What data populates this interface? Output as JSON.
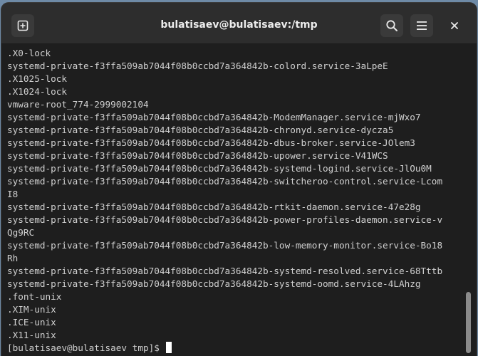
{
  "window": {
    "title": "bulatisaev@bulatisaev:/tmp"
  },
  "titlebar": {
    "new_tab_icon": "new-tab-icon",
    "search_icon": "search-icon",
    "menu_icon": "hamburger-menu-icon",
    "close_icon": "close-icon"
  },
  "terminal": {
    "lines": [
      ".X0-lock",
      "systemd-private-f3ffa509ab7044f08b0ccbd7a364842b-colord.service-3aLpeE",
      ".X1025-lock",
      ".X1024-lock",
      "vmware-root_774-2999002104",
      "systemd-private-f3ffa509ab7044f08b0ccbd7a364842b-ModemManager.service-mjWxo7",
      "systemd-private-f3ffa509ab7044f08b0ccbd7a364842b-chronyd.service-dycza5",
      "systemd-private-f3ffa509ab7044f08b0ccbd7a364842b-dbus-broker.service-JOlem3",
      "systemd-private-f3ffa509ab7044f08b0ccbd7a364842b-upower.service-V41WCS",
      "systemd-private-f3ffa509ab7044f08b0ccbd7a364842b-systemd-logind.service-JlOu0M",
      "systemd-private-f3ffa509ab7044f08b0ccbd7a364842b-switcheroo-control.service-Lcom",
      "I8",
      "systemd-private-f3ffa509ab7044f08b0ccbd7a364842b-rtkit-daemon.service-47e28g",
      "systemd-private-f3ffa509ab7044f08b0ccbd7a364842b-power-profiles-daemon.service-v",
      "Qg9RC",
      "systemd-private-f3ffa509ab7044f08b0ccbd7a364842b-low-memory-monitor.service-Bo18",
      "Rh",
      "systemd-private-f3ffa509ab7044f08b0ccbd7a364842b-systemd-resolved.service-68Tttb",
      "systemd-private-f3ffa509ab7044f08b0ccbd7a364842b-systemd-oomd.service-4LAhzg",
      ".font-unix",
      ".XIM-unix",
      ".ICE-unix",
      ".X11-unix"
    ],
    "prompt": "[bulatisaev@bulatisaev tmp]$ "
  },
  "colors": {
    "terminal_bg": "#1e1e1e",
    "titlebar_bg": "#2d2d2d",
    "text": "#d0d0d0",
    "desktop_bg": "#6e8aa6"
  }
}
